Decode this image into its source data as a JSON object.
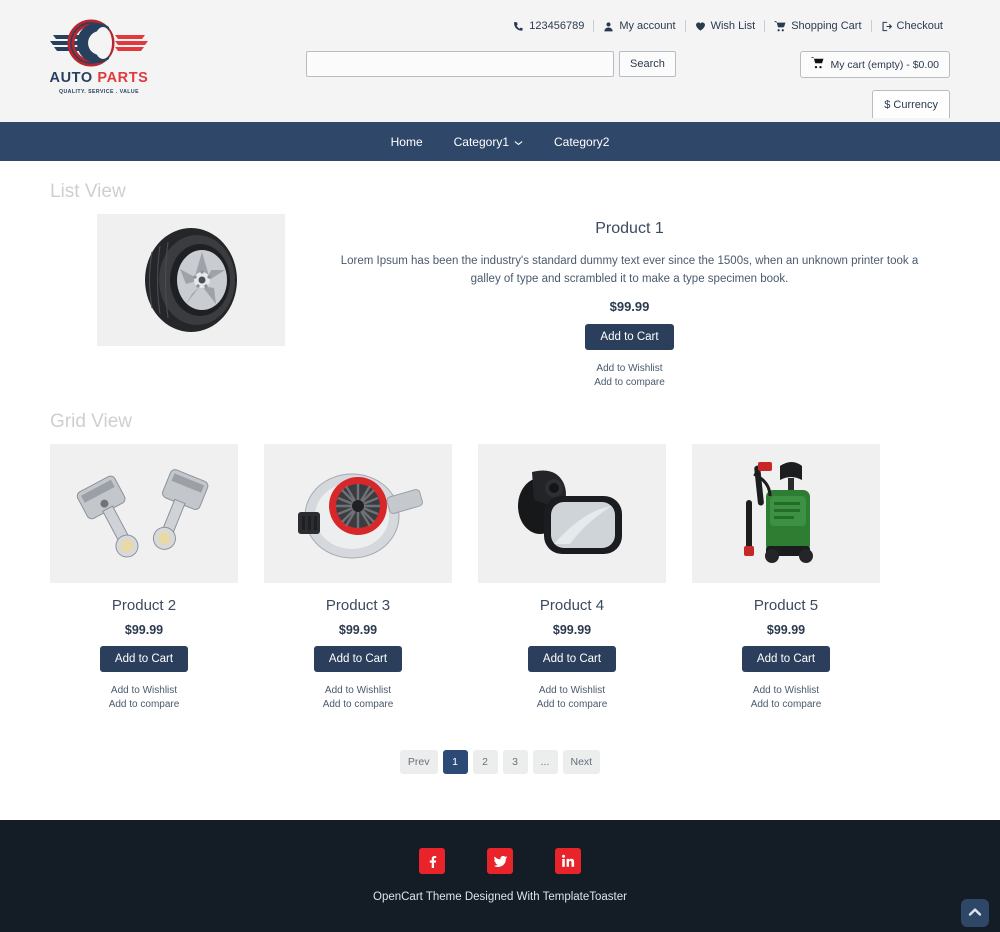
{
  "header": {
    "logo": {
      "brand_top": "AUTO",
      "brand_bottom": "PARTS",
      "tagline": "QUALITY. SERVICE . VALUE"
    },
    "toplinks": [
      {
        "label": "123456789",
        "icon": "phone-icon"
      },
      {
        "label": "My account",
        "icon": "user-icon"
      },
      {
        "label": "Wish List",
        "icon": "heart-icon"
      },
      {
        "label": "Shopping Cart",
        "icon": "cart-icon"
      },
      {
        "label": "Checkout",
        "icon": "checkout-icon"
      }
    ],
    "search": {
      "value": "",
      "placeholder": "",
      "button_label": "Search"
    },
    "cart_label": "My cart (empty) - $0.00",
    "currency_label": "$ Currency"
  },
  "nav": {
    "items": [
      {
        "label": "Home",
        "has_dropdown": false
      },
      {
        "label": "Category1",
        "has_dropdown": true
      },
      {
        "label": "Category2",
        "has_dropdown": false
      }
    ]
  },
  "main": {
    "list_view": {
      "heading": "List View",
      "product": {
        "name": "Product 1",
        "description": "Lorem Ipsum has been the industry's standard dummy text ever since the 1500s, when an unknown printer took a galley of type and scrambled it to make a type specimen book.",
        "price": "$99.99",
        "add_to_cart": "Add to Cart",
        "wishlist": "Add to Wishlist",
        "compare": "Add to compare",
        "image": "tire-wheel-image"
      }
    },
    "grid_view": {
      "heading": "Grid View",
      "products": [
        {
          "name": "Product 2",
          "price": "$99.99",
          "add_to_cart": "Add to Cart",
          "wishlist": "Add to Wishlist",
          "compare": "Add to compare",
          "image": "piston-connecting-rod-image"
        },
        {
          "name": "Product 3",
          "price": "$99.99",
          "add_to_cart": "Add to Cart",
          "wishlist": "Add to Wishlist",
          "compare": "Add to compare",
          "image": "turbocharger-image"
        },
        {
          "name": "Product 4",
          "price": "$99.99",
          "add_to_cart": "Add to Cart",
          "wishlist": "Add to Wishlist",
          "compare": "Add to compare",
          "image": "side-mirror-image"
        },
        {
          "name": "Product 5",
          "price": "$99.99",
          "add_to_cart": "Add to Cart",
          "wishlist": "Add to Wishlist",
          "compare": "Add to compare",
          "image": "pressure-washer-image"
        }
      ]
    },
    "pagination": [
      {
        "label": "Prev",
        "active": false
      },
      {
        "label": "1",
        "active": true
      },
      {
        "label": "2",
        "active": false
      },
      {
        "label": "3",
        "active": false
      },
      {
        "label": "...",
        "active": false
      },
      {
        "label": "Next",
        "active": false
      }
    ]
  },
  "footer": {
    "social": [
      {
        "name": "facebook-icon",
        "glyph": "f"
      },
      {
        "name": "twitter-icon",
        "glyph": "t"
      },
      {
        "name": "linkedin-icon",
        "glyph": "in"
      }
    ],
    "text": "OpenCart Theme Designed With TemplateToaster",
    "to_top": "scroll-to-top"
  },
  "colors": {
    "nav_bar": "#2f4769",
    "button_primary": "#2b3f5c",
    "footer_bg": "#141c26",
    "header_bg": "#f4f4f4",
    "accent_red": "#e8232a",
    "pagination_active": "#2b4a76",
    "section_title": "#cfcfcf"
  }
}
